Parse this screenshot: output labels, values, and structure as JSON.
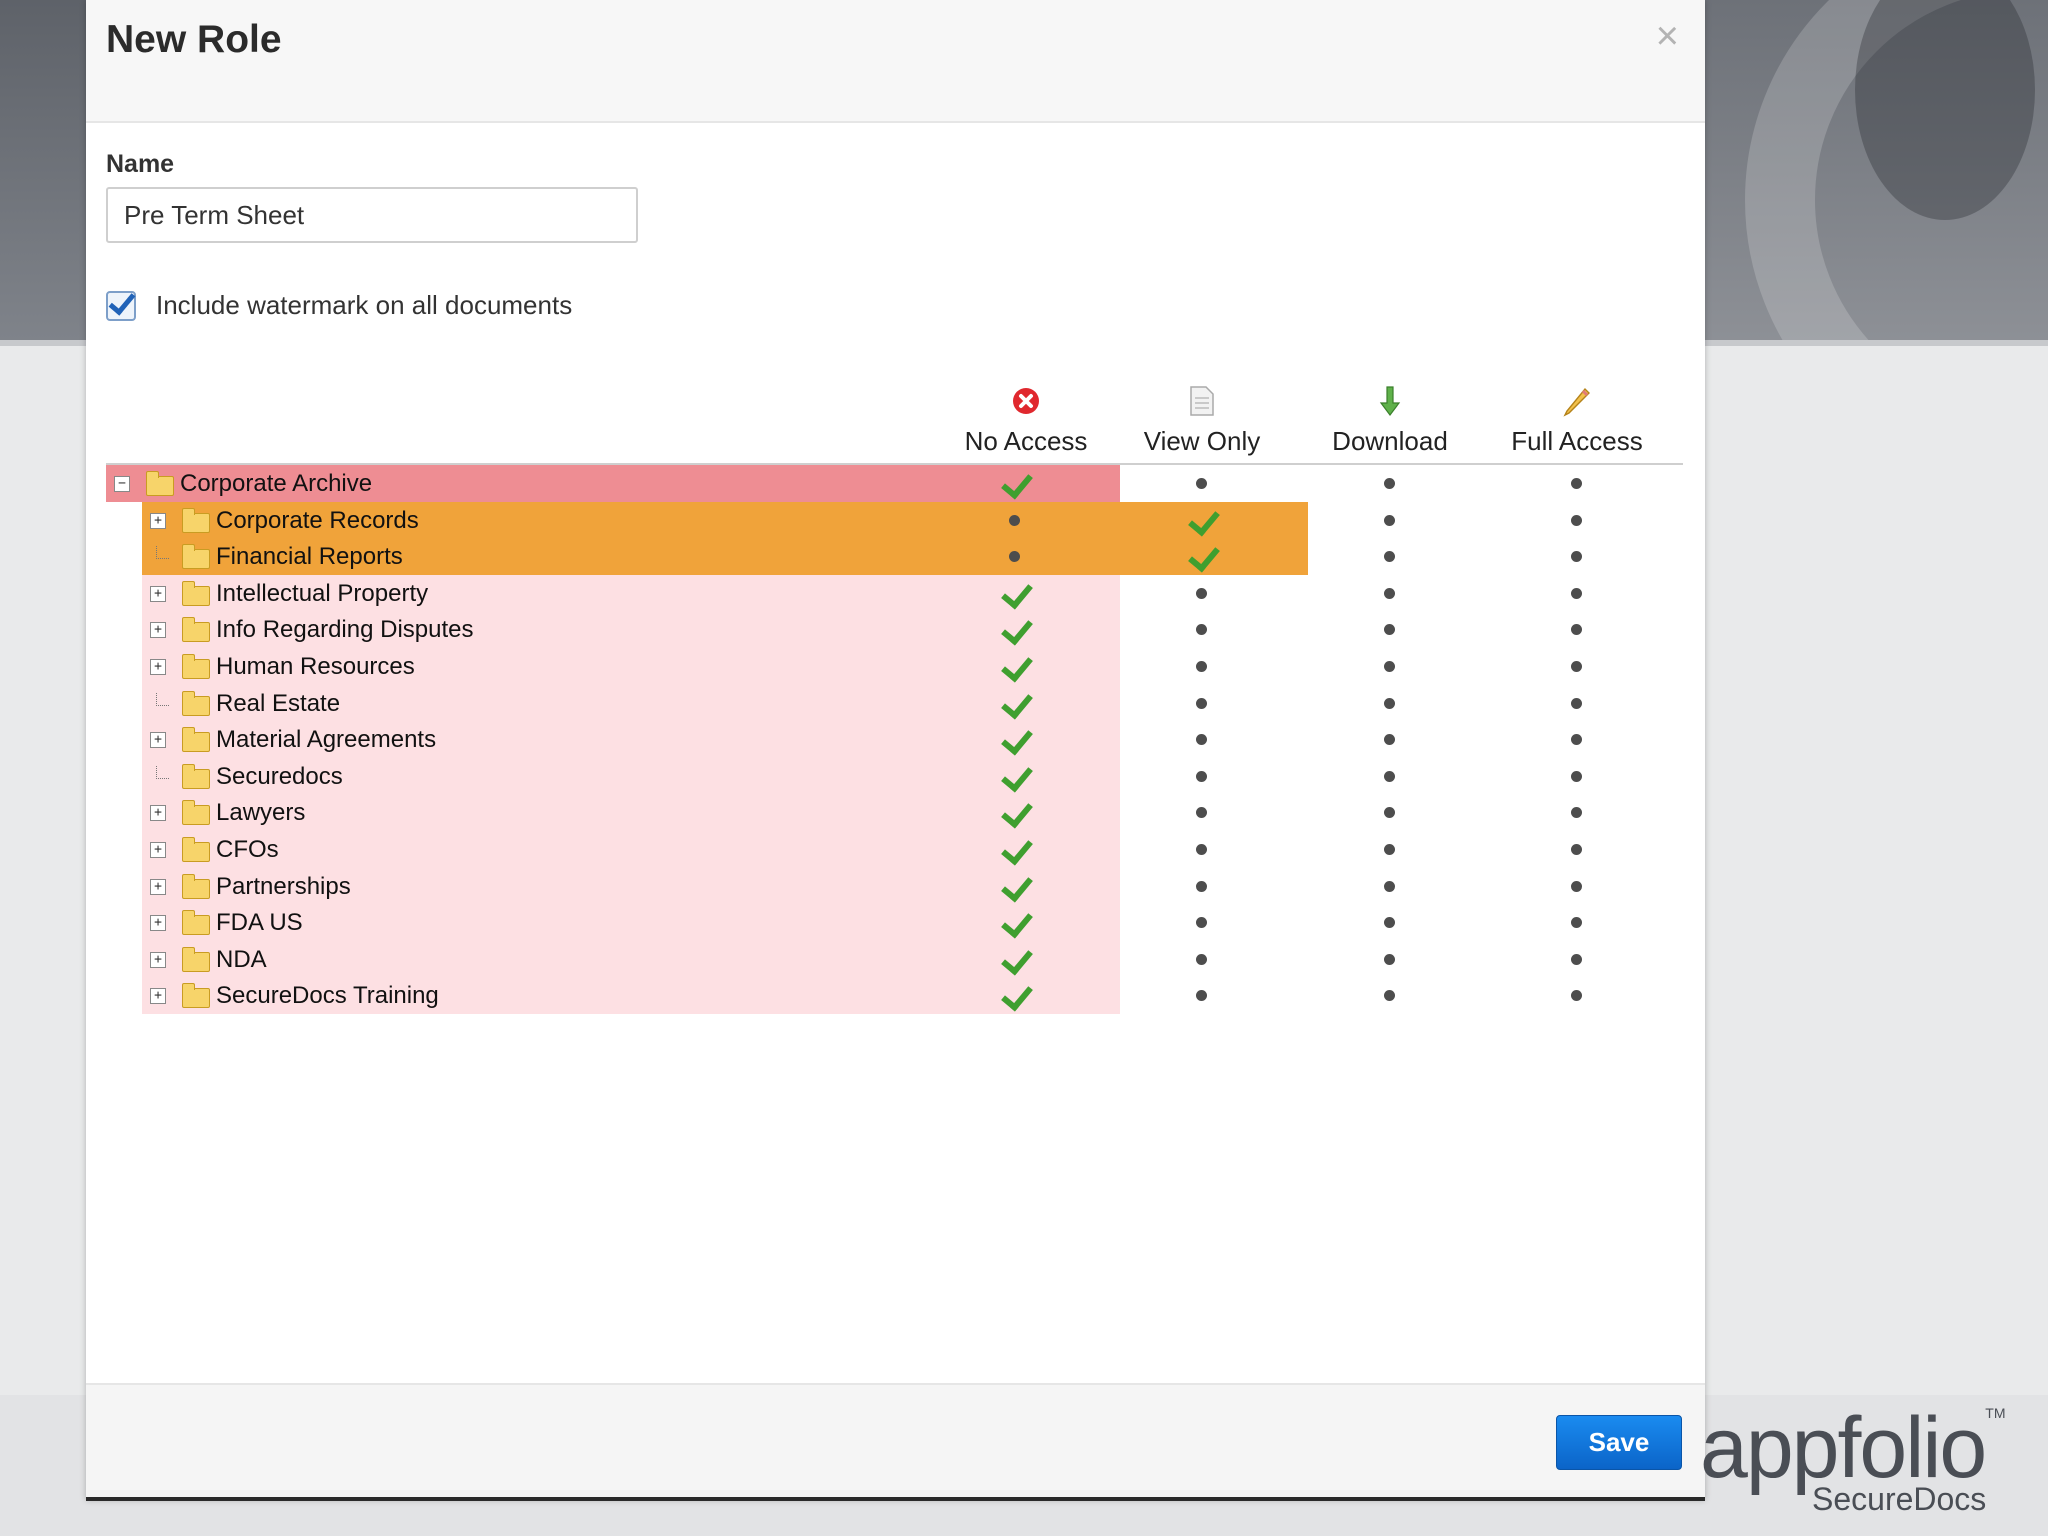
{
  "dialog": {
    "title": "New Role",
    "close_symbol": "×"
  },
  "name_field": {
    "label": "Name",
    "value": "Pre Term Sheet"
  },
  "watermark": {
    "label": "Include watermark on all documents",
    "checked": true
  },
  "columns": [
    {
      "label": "No Access",
      "icon": "red-x-icon"
    },
    {
      "label": "View Only",
      "icon": "document-icon"
    },
    {
      "label": "Download",
      "icon": "download-arrow-icon"
    },
    {
      "label": "Full Access",
      "icon": "pencil-icon"
    }
  ],
  "folders": [
    {
      "label": "Corporate Archive",
      "level": 0,
      "expander": "minus",
      "access": "No Access"
    },
    {
      "label": "Corporate Records",
      "level": 1,
      "expander": "plus",
      "access": "View Only"
    },
    {
      "label": "Financial Reports",
      "level": 1,
      "expander": "none",
      "access": "View Only"
    },
    {
      "label": "Intellectual Property",
      "level": 1,
      "expander": "plus",
      "access": "No Access"
    },
    {
      "label": "Info Regarding Disputes",
      "level": 1,
      "expander": "plus",
      "access": "No Access"
    },
    {
      "label": "Human Resources",
      "level": 1,
      "expander": "plus",
      "access": "No Access"
    },
    {
      "label": "Real Estate",
      "level": 1,
      "expander": "none",
      "access": "No Access"
    },
    {
      "label": "Material Agreements",
      "level": 1,
      "expander": "plus",
      "access": "No Access"
    },
    {
      "label": "Securedocs",
      "level": 1,
      "expander": "none",
      "access": "No Access"
    },
    {
      "label": "Lawyers",
      "level": 1,
      "expander": "plus",
      "access": "No Access"
    },
    {
      "label": "CFOs",
      "level": 1,
      "expander": "plus",
      "access": "No Access"
    },
    {
      "label": "Partnerships",
      "level": 1,
      "expander": "plus",
      "access": "No Access"
    },
    {
      "label": "FDA US",
      "level": 1,
      "expander": "plus",
      "access": "No Access"
    },
    {
      "label": "NDA",
      "level": 1,
      "expander": "plus",
      "access": "No Access"
    },
    {
      "label": "SecureDocs Training",
      "level": 1,
      "expander": "plus",
      "access": "No Access"
    }
  ],
  "colors": {
    "no_access_strong": "#ee8d93",
    "no_access_light": "#fde0e3",
    "view_only": "#f0a33a",
    "check_green": "#3f9f2f",
    "save_blue": "#1178dd"
  },
  "footer": {
    "save_label": "Save"
  },
  "brand": {
    "logo_text": "appfolio",
    "logo_tm": "TM",
    "logo_sub": "SecureDocs"
  }
}
